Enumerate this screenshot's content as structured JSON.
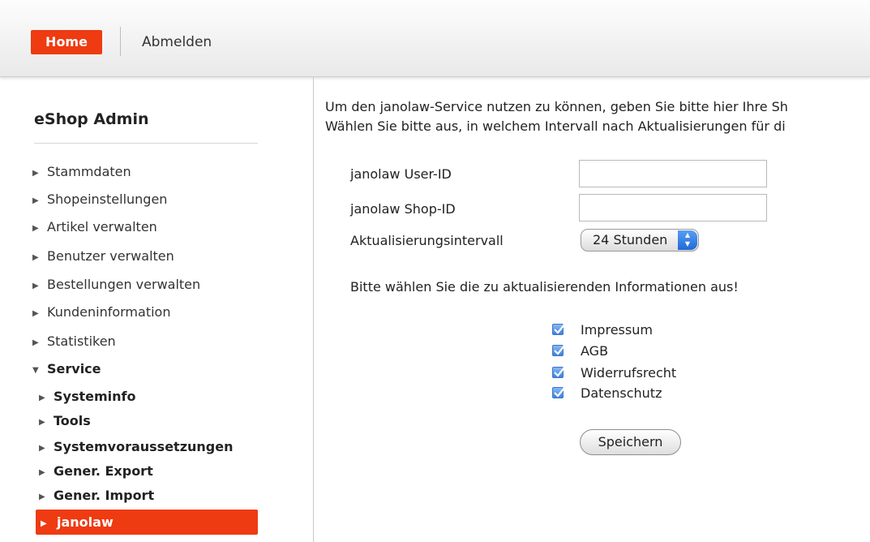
{
  "topbar": {
    "home_label": "Home",
    "logout_label": "Abmelden"
  },
  "sidebar": {
    "title": "eShop Admin",
    "items": [
      {
        "label": "Stammdaten"
      },
      {
        "label": "Shopeinstellungen"
      },
      {
        "label": "Artikel verwalten"
      },
      {
        "label": "Benutzer verwalten"
      },
      {
        "label": "Bestellungen verwalten"
      },
      {
        "label": "Kundeninformation"
      },
      {
        "label": "Statistiken"
      },
      {
        "label": "Service"
      }
    ],
    "subitems": [
      {
        "label": "Systeminfo"
      },
      {
        "label": "Tools"
      },
      {
        "label": "Systemvoraussetzungen"
      },
      {
        "label": "Gener. Export"
      },
      {
        "label": "Gener. Import"
      },
      {
        "label": "janolaw"
      }
    ]
  },
  "main": {
    "intro_line1": "Um den janolaw-Service nutzen zu können, geben Sie bitte hier Ihre Sh",
    "intro_line2": "Wählen Sie bitte aus, in welchem Intervall nach Aktualisierungen für di",
    "userid_label": "janolaw User-ID",
    "userid_value": "",
    "shopid_label": "janolaw Shop-ID",
    "shopid_value": "",
    "interval_label": "Aktualisierungsintervall",
    "interval_value": "24 Stunden",
    "instruction": "Bitte wählen Sie die zu aktualisierenden Informationen aus!",
    "checkboxes": [
      {
        "label": "Impressum",
        "checked": true
      },
      {
        "label": "AGB",
        "checked": true
      },
      {
        "label": "Widerrufsrecht",
        "checked": true
      },
      {
        "label": "Datenschutz",
        "checked": true
      }
    ],
    "save_label": "Speichern"
  }
}
